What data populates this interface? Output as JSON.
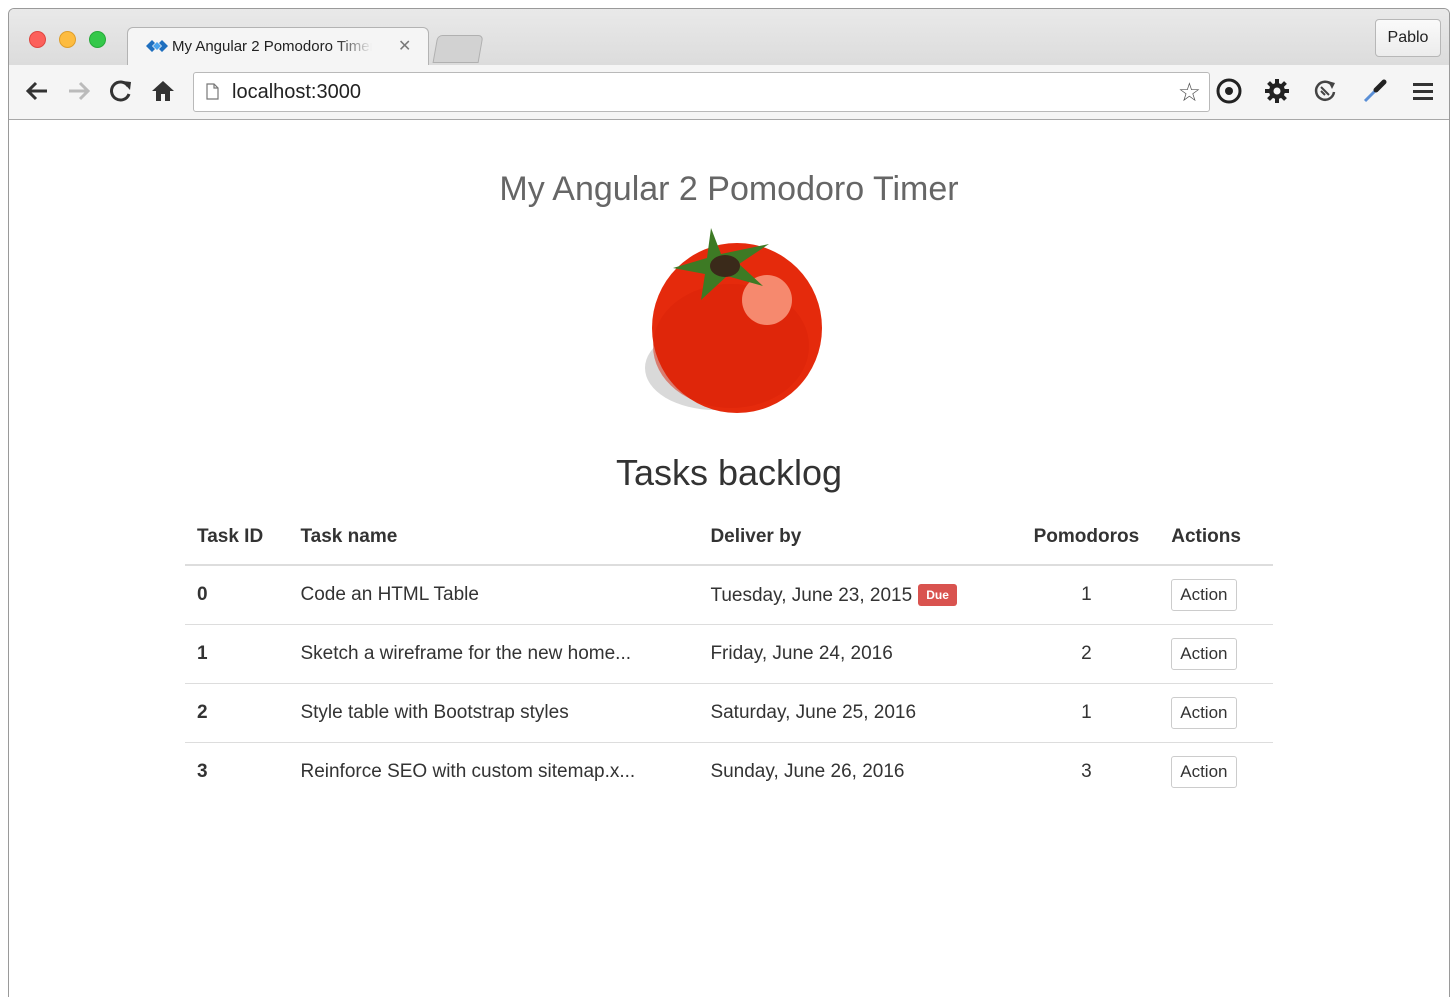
{
  "browser": {
    "tab_title": "My Angular 2 Pomodoro Timer",
    "profile_name": "Pablo",
    "url": "localhost:3000",
    "icons": {
      "back": "arrow-left-icon",
      "forward": "arrow-right-icon",
      "reload": "reload-icon",
      "home": "home-icon",
      "bookmark": "star-icon",
      "ext1": "chrome-extension-icon",
      "settings": "gear-icon",
      "ext2": "sync-icon",
      "ext3": "eyedropper-icon",
      "menu": "hamburger-menu-icon"
    }
  },
  "page": {
    "title": "My Angular 2 Pomodoro Timer",
    "backlog_heading": "Tasks backlog",
    "columns": [
      "Task ID",
      "Task name",
      "Deliver by",
      "Pomodoros",
      "Actions"
    ],
    "tasks": [
      {
        "id": "0",
        "name": "Code an HTML Table",
        "deliver_by": "Tuesday, June 23, 2015",
        "badge": "Due",
        "pomodoros": "1",
        "action": "Action"
      },
      {
        "id": "1",
        "name": "Sketch a wireframe for the new home...",
        "deliver_by": "Friday, June 24, 2016",
        "badge": "",
        "pomodoros": "2",
        "action": "Action"
      },
      {
        "id": "2",
        "name": "Style table with Bootstrap styles",
        "deliver_by": "Saturday, June 25, 2016",
        "badge": "",
        "pomodoros": "1",
        "action": "Action"
      },
      {
        "id": "3",
        "name": "Reinforce SEO with custom sitemap.x...",
        "deliver_by": "Sunday, June 26, 2016",
        "badge": "",
        "pomodoros": "3",
        "action": "Action"
      }
    ]
  },
  "colors": {
    "due_badge": "#d9534f",
    "tomato": "#e52a0c",
    "stem": "#3d7a24"
  }
}
